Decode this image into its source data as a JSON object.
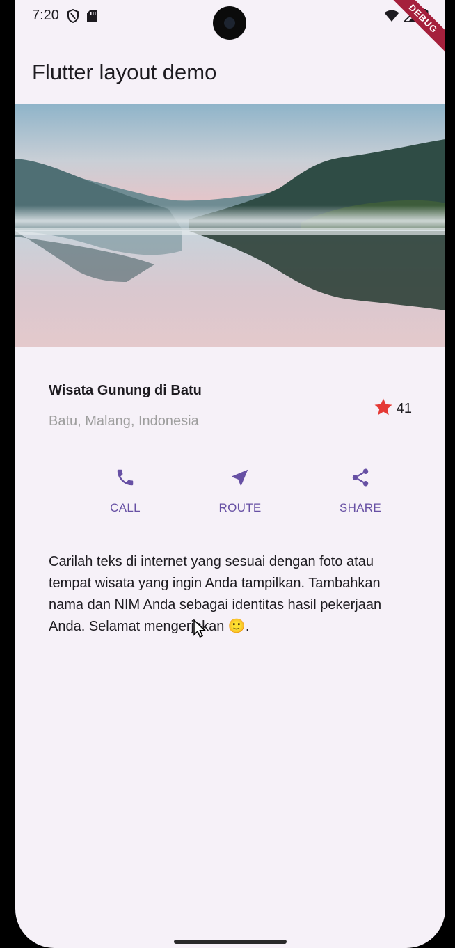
{
  "status_bar": {
    "time": "7:20",
    "debug_label": "DEBUG"
  },
  "app_bar": {
    "title": "Flutter layout demo"
  },
  "hero_image": {
    "description_icon": "mountain-lake-photo"
  },
  "title_section": {
    "title": "Wisata Gunung di Batu",
    "location": "Batu, Malang, Indonesia",
    "rating_count": "41",
    "star_color": "#e53935"
  },
  "buttons": [
    {
      "label": "CALL",
      "icon": "phone-icon"
    },
    {
      "label": "ROUTE",
      "icon": "navigation-icon"
    },
    {
      "label": "SHARE",
      "icon": "share-icon"
    }
  ],
  "accent_color": "#6750a4",
  "description": "Carilah teks di internet yang sesuai dengan foto atau tempat wisata yang ingin Anda tampilkan. Tambahkan nama dan NIM Anda sebagai identitas hasil pekerjaan Anda. Selamat mengerjakan 🙂."
}
